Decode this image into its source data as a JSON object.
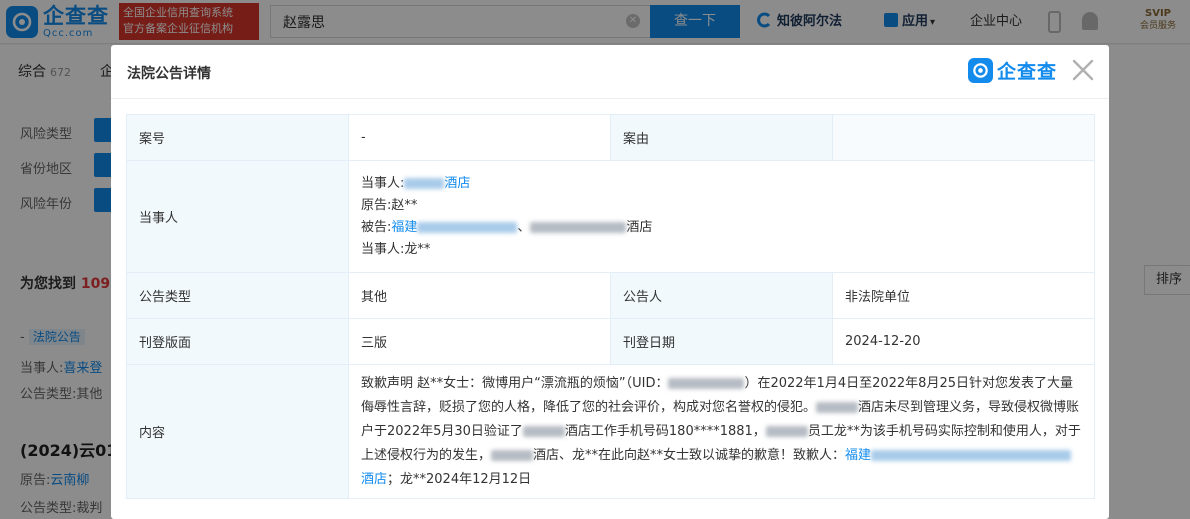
{
  "header": {
    "logo_cn": "企查查",
    "logo_en": "Qcc.com",
    "banner_line1": "全国企业信用查询系统",
    "banner_line2": "官方备案企业征信机构",
    "search_value": "赵露思",
    "search_button": "查一下",
    "alpha_label": "知彼阿尔法",
    "apps_label": "应用",
    "apps_caret": "▾",
    "enterprise_center": "企业中心",
    "svip_line1": "SVIP",
    "svip_line2": "会员服务"
  },
  "background": {
    "tab_all": "综合",
    "tab_all_count": "672",
    "tab_second": "企",
    "filters": [
      "风险类型",
      "省份地区",
      "风险年份"
    ],
    "found_prefix": "为您找到",
    "found_count": "109",
    "sort_label": "排序",
    "row1_dash": "-",
    "row1_tag": "法院公告",
    "row1_party_label": "当事人:",
    "row1_party_value": "喜来登",
    "row1_type_label": "公告类型:",
    "row1_type_value": "其他",
    "row2_title": "(2024)云01",
    "row2_origin_label": "原告:",
    "row2_origin_value": "云南柳",
    "row2_type_label": "公告类型:",
    "row2_type_value": "裁判"
  },
  "modal": {
    "title": "法院公告详情",
    "logo_text": "企查查",
    "case_no_label": "案号",
    "case_no_value": "-",
    "cause_label": "案由",
    "cause_value": "",
    "parties_label": "当事人",
    "party1_prefix": "当事人:",
    "party1_suffix": "酒店",
    "plaintiff_prefix": "原告:",
    "plaintiff_value": "赵**",
    "defendant_prefix": "被告:",
    "defendant_link": "福建",
    "defendant_sep": "、",
    "defendant_suffix": "酒店",
    "party4_prefix": "当事人:",
    "party4_value": "龙**",
    "notice_type_label": "公告类型",
    "notice_type_value": "其他",
    "announcer_label": "公告人",
    "announcer_value": "非法院单位",
    "edition_label": "刊登版面",
    "edition_value": "三版",
    "date_label": "刊登日期",
    "date_value": "2024-12-20",
    "content_label": "内容",
    "content_p1": "致歉声明 赵**女士：微博用户“漂流瓶的烦恼”（UID：",
    "content_p2": "）在2022年1月4日至2022年8月25日针对您发表了大量侮辱性言辞，贬损了您的人格，降低了您的社会评价，构成对您名誉权的侵犯。",
    "content_p3": "酒店未尽到管理义务，导致侵权微博账户于2022年5月30日验证了",
    "content_p4": "酒店工作手机号码180****1881，",
    "content_p5": "员工龙**为该手机号码实际控制和使用人，对于上述侵权行为的发生，",
    "content_p6": "酒店、龙**在此向赵**女士致以诚挚的歉意！致歉人：",
    "content_link1": "福建",
    "content_link2": "酒店",
    "content_p7": "；龙**2024年12月12日"
  },
  "colors": {
    "brand_blue": "#128bed",
    "banner_red": "#d9362b",
    "label_bg": "#f2f9fc"
  }
}
